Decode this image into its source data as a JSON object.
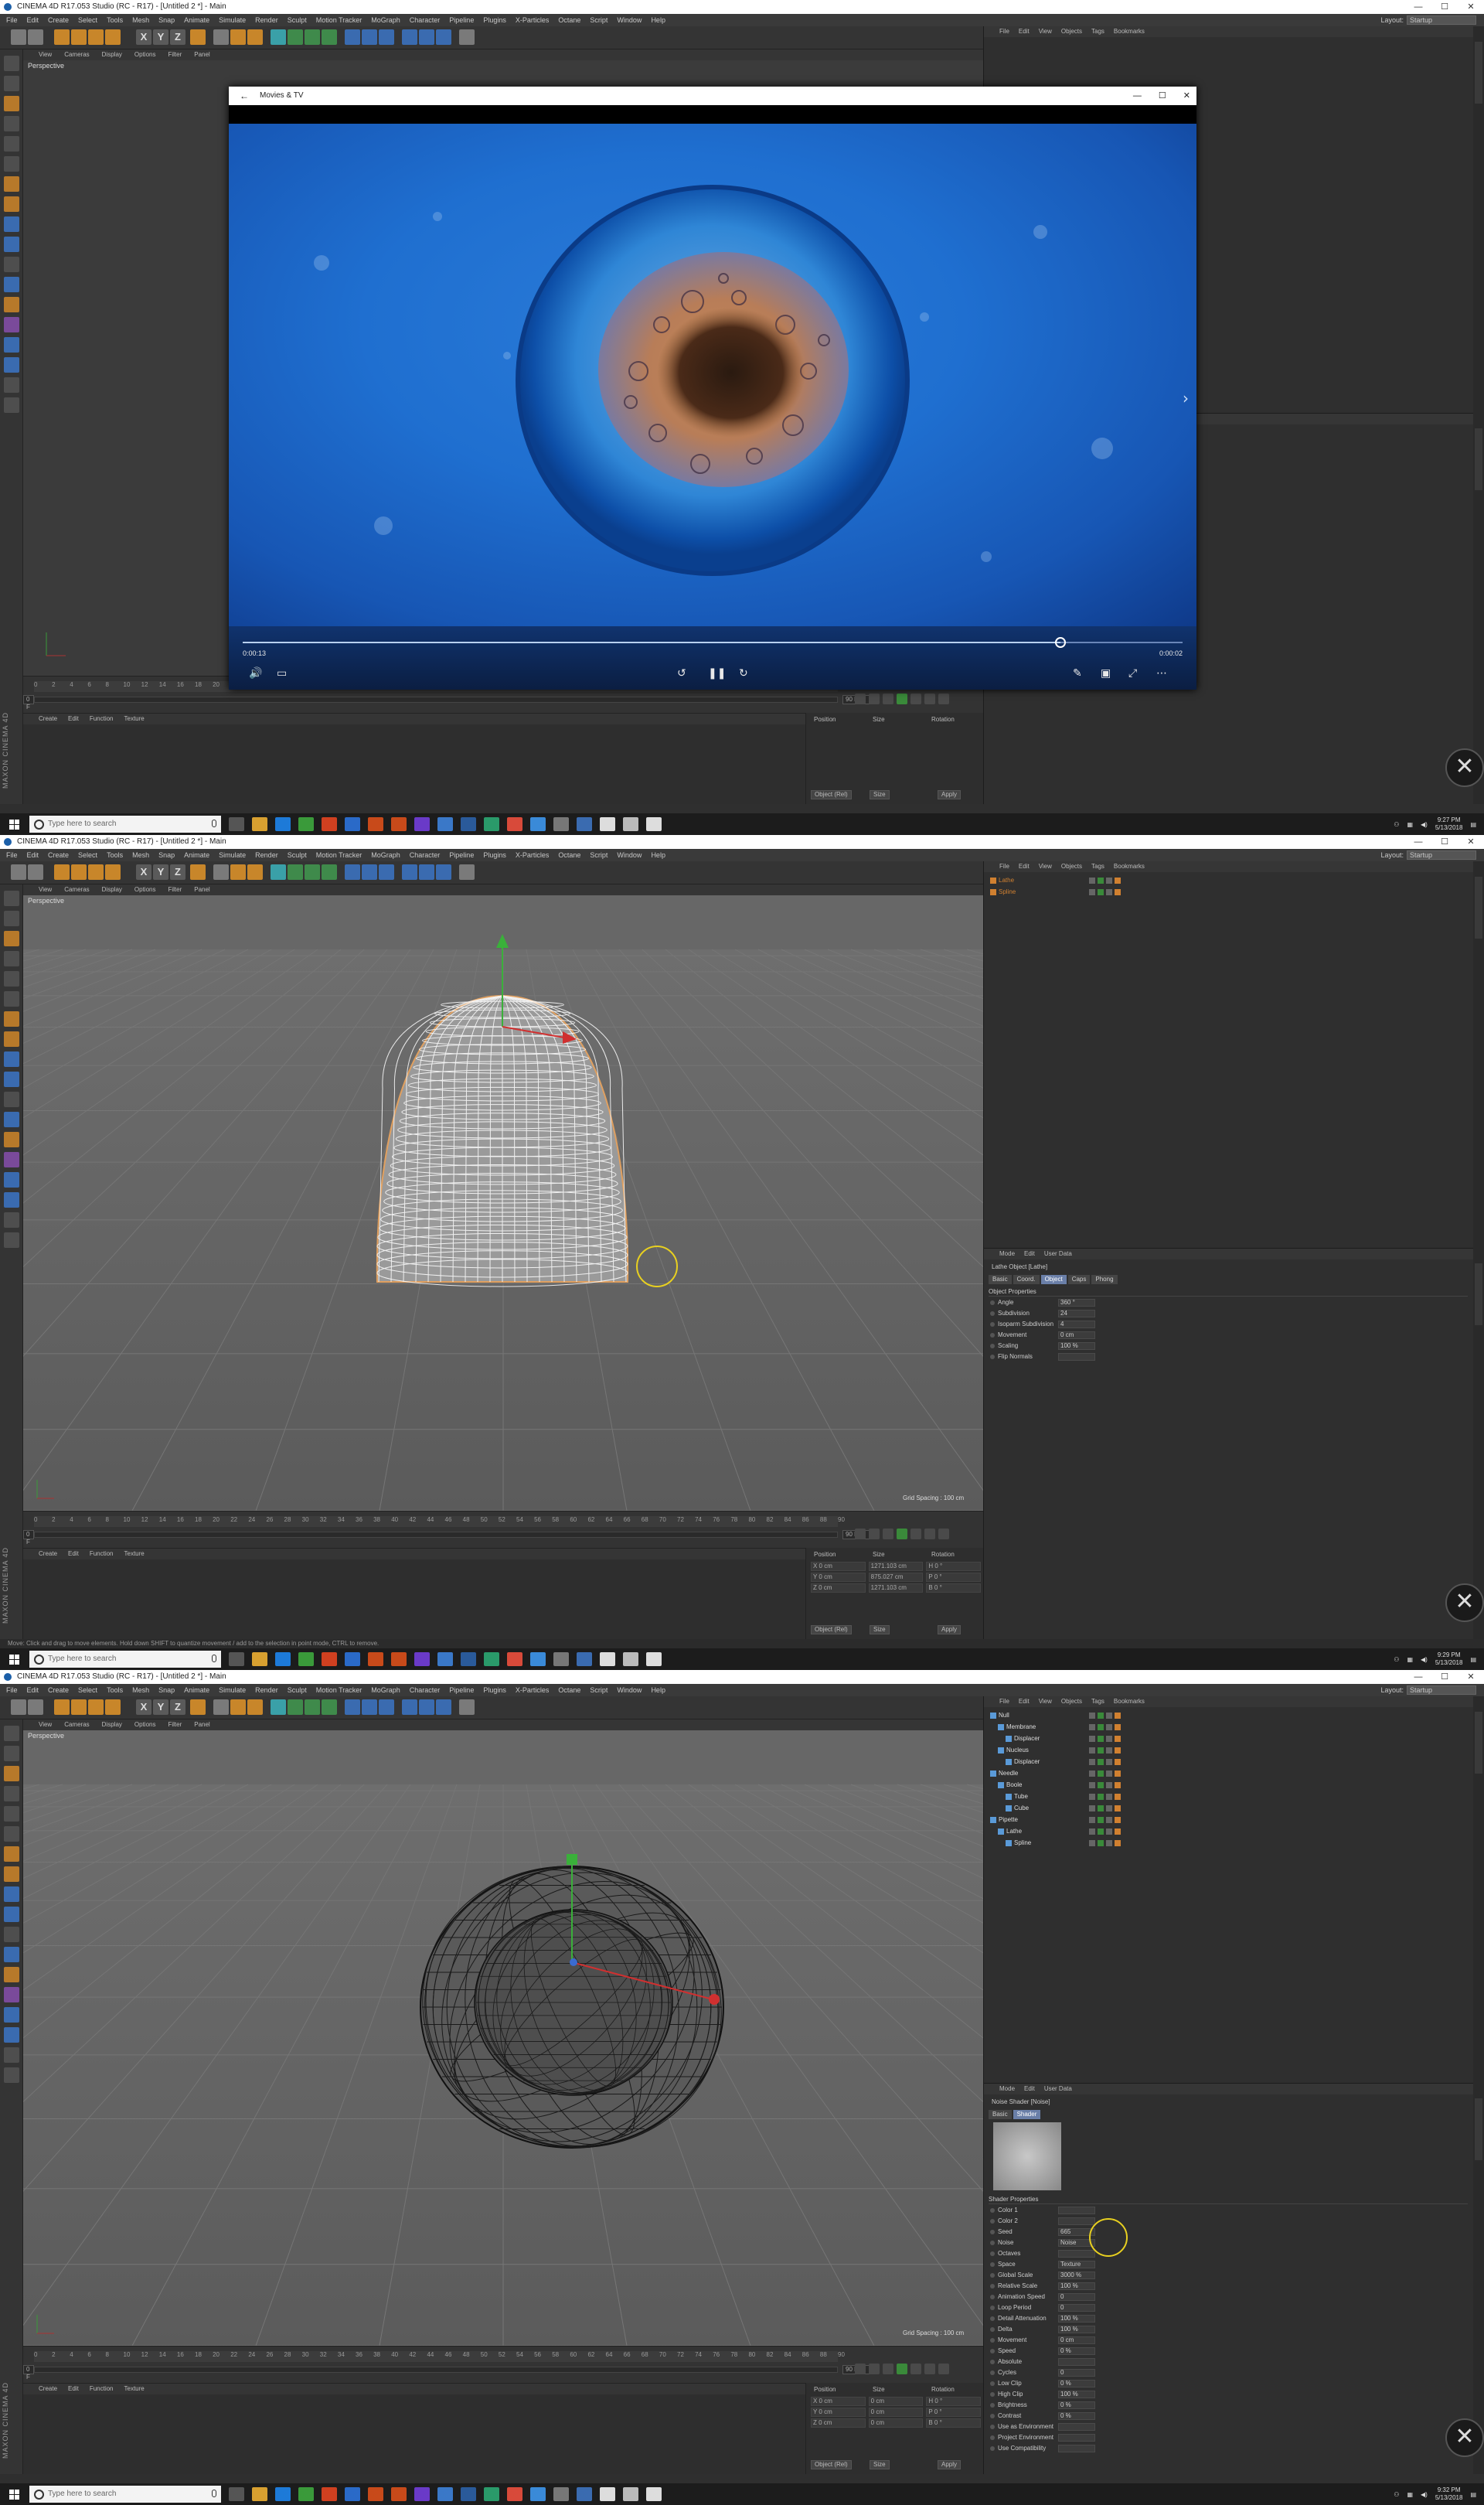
{
  "app": {
    "menu": [
      "File",
      "Edit",
      "Create",
      "Select",
      "Tools",
      "Mesh",
      "Snap",
      "Animate",
      "Simulate",
      "Render",
      "Sculpt",
      "Motion Tracker",
      "MoGraph",
      "Character",
      "Pipeline",
      "Plugins",
      "X-Particles",
      "Octane",
      "Script",
      "Window",
      "Help"
    ],
    "layout_label": "Layout:",
    "layout_value": "Startup",
    "viewport_menu": [
      "View",
      "Cameras",
      "Display",
      "Options",
      "Filter",
      "Panel"
    ],
    "viewport_name": "Perspective",
    "grid_spacing": "Grid Spacing : 100 cm",
    "material_menu": [
      "Create",
      "Edit",
      "Function",
      "Texture"
    ],
    "coord_headers": [
      "Position",
      "Size",
      "Rotation"
    ],
    "coord_apply": "Apply",
    "coord_mode_1": "Object (Rel)",
    "coord_mode_2": "Size",
    "object_menu": [
      "File",
      "Edit",
      "View",
      "Objects",
      "Tags",
      "Bookmarks"
    ],
    "attr_menu": [
      "Mode",
      "Edit",
      "User Data"
    ],
    "timeline_ticks": [
      "0",
      "2",
      "4",
      "6",
      "8",
      "10",
      "12",
      "14",
      "16",
      "18",
      "20",
      "22",
      "24",
      "26",
      "28",
      "30",
      "32",
      "34",
      "36",
      "38",
      "40",
      "42",
      "44",
      "46",
      "48",
      "50",
      "52",
      "54",
      "56",
      "58",
      "60",
      "62",
      "64",
      "66",
      "68",
      "70",
      "72",
      "74",
      "76",
      "78",
      "80",
      "82",
      "84",
      "86",
      "88",
      "90"
    ],
    "frame_start": "0 F",
    "frame_end": "90 F",
    "maxon": "MAXON CINEMA 4D",
    "colors": {
      "accent_orange": "#d08030",
      "accent_blue": "#3a6bb0",
      "selected_tab": "#6a7fa8"
    }
  },
  "taskbar": {
    "search_placeholder": "Type here to search"
  },
  "frame1": {
    "title": "CINEMA 4D R17.053 Studio (RC - R17) - [Untitled 2 *] - Main",
    "player": {
      "title": "Movies & TV",
      "elapsed": "0:00:13",
      "remaining": "0:00:02",
      "progress": 0.87
    },
    "clock_time": "9:27 PM",
    "clock_date": "5/13/2018"
  },
  "frame2": {
    "title": "CINEMA 4D R17.053 Studio (RC - R17) - [Untitled 2 *] - Main",
    "objects": [
      {
        "name": "Lathe",
        "color": "#d08030"
      },
      {
        "name": "Spline",
        "color": "#d08030"
      }
    ],
    "attr_title": "Lathe Object [Lathe]",
    "attr_tabs": [
      "Basic",
      "Coord.",
      "Object",
      "Caps",
      "Phong"
    ],
    "attr_active_tab": "Object",
    "section": "Object Properties",
    "properties": [
      {
        "label": "Angle",
        "value": "360 °"
      },
      {
        "label": "Subdivision",
        "value": "24"
      },
      {
        "label": "Isoparm Subdivision",
        "value": "4"
      },
      {
        "label": "Movement",
        "value": "0 cm"
      },
      {
        "label": "Scaling",
        "value": "100 %"
      },
      {
        "label": "Flip Normals",
        "value": ""
      }
    ],
    "coords": [
      [
        "X  0 cm",
        "1271.103 cm",
        "H  0 °"
      ],
      [
        "Y  0 cm",
        "875.027 cm",
        "P  0 °"
      ],
      [
        "Z  0 cm",
        "1271.103 cm",
        "B  0 °"
      ]
    ],
    "status": "Move: Click and drag to move elements. Hold down SHIFT to quantize movement / add to the selection in point mode, CTRL to remove.",
    "clock_time": "9:29 PM",
    "clock_date": "5/13/2018"
  },
  "frame3": {
    "title": "CINEMA 4D R17.053 Studio (RC - R17) - [Untitled 2 *] - Main",
    "objects": [
      {
        "name": "Null",
        "depth": 0
      },
      {
        "name": "Membrane",
        "depth": 1
      },
      {
        "name": "Displacer",
        "depth": 2
      },
      {
        "name": "Nucleus",
        "depth": 1
      },
      {
        "name": "Displacer",
        "depth": 2
      },
      {
        "name": "Needle",
        "depth": 0
      },
      {
        "name": "Boole",
        "depth": 1
      },
      {
        "name": "Tube",
        "depth": 2
      },
      {
        "name": "Cube",
        "depth": 2
      },
      {
        "name": "Pipette",
        "depth": 0
      },
      {
        "name": "Lathe",
        "depth": 1
      },
      {
        "name": "Spline",
        "depth": 2
      }
    ],
    "attr_title": "Noise Shader [Noise]",
    "attr_tabs": [
      "Basic",
      "Shader"
    ],
    "attr_active_tab": "Shader",
    "section": "Shader Properties",
    "properties": [
      {
        "label": "Color 1",
        "value": ""
      },
      {
        "label": "Color 2",
        "value": ""
      },
      {
        "label": "Seed",
        "value": "665"
      },
      {
        "label": "Noise",
        "value": "Noise"
      },
      {
        "label": "Octaves",
        "value": ""
      },
      {
        "label": "Space",
        "value": "Texture"
      },
      {
        "label": "Global Scale",
        "value": "3000 %"
      },
      {
        "label": "Relative Scale",
        "value": "100 %"
      },
      {
        "label": "Animation Speed",
        "value": "0"
      },
      {
        "label": "Loop Period",
        "value": "0"
      },
      {
        "label": "Detail Attenuation",
        "value": "100 %"
      },
      {
        "label": "Delta",
        "value": "100 %"
      },
      {
        "label": "Movement",
        "value": "0 cm"
      },
      {
        "label": "Speed",
        "value": "0 %"
      },
      {
        "label": "Absolute",
        "value": ""
      },
      {
        "label": "Cycles",
        "value": "0"
      },
      {
        "label": "Low Clip",
        "value": "0 %"
      },
      {
        "label": "High Clip",
        "value": "100 %"
      },
      {
        "label": "Brightness",
        "value": "0 %"
      },
      {
        "label": "Contrast",
        "value": "0 %"
      },
      {
        "label": "Use as Environment",
        "value": ""
      },
      {
        "label": "Project Environment",
        "value": ""
      },
      {
        "label": "Use Compatibility",
        "value": ""
      }
    ],
    "coords": [
      [
        "X  0 cm",
        "0 cm",
        "H  0 °"
      ],
      [
        "Y  0 cm",
        "0 cm",
        "P  0 °"
      ],
      [
        "Z  0 cm",
        "0 cm",
        "B  0 °"
      ]
    ],
    "clock_time": "9:32 PM",
    "clock_date": "5/13/2018"
  }
}
